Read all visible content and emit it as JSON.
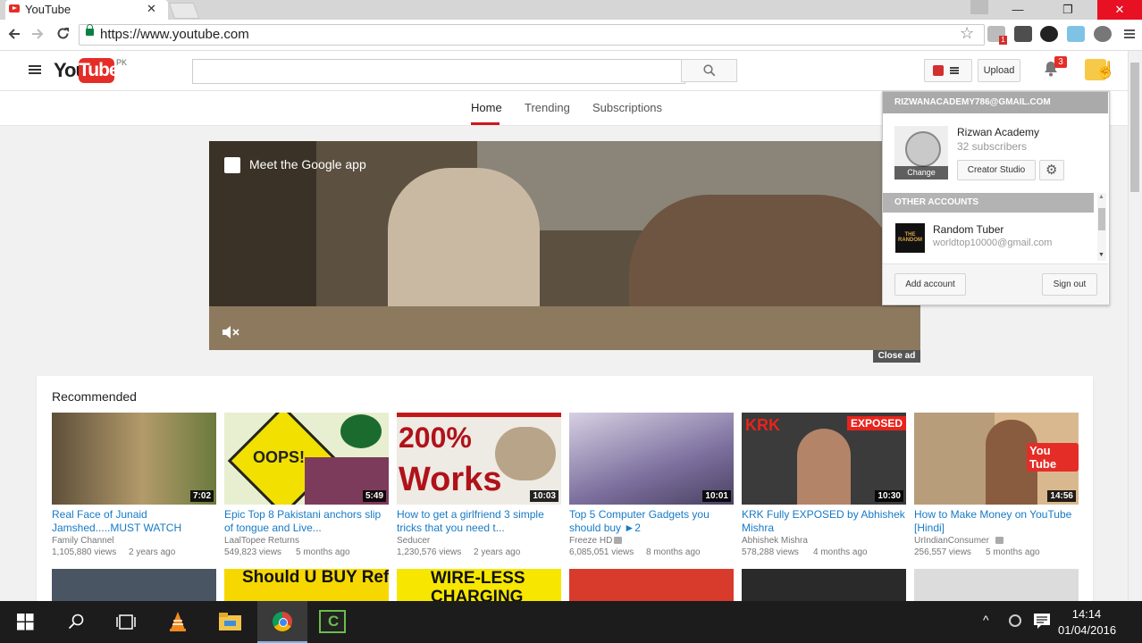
{
  "browser": {
    "tab_title": "YouTube",
    "tab_close": "✕",
    "url": "https://www.youtube.com",
    "window_controls": [
      "—",
      "❐",
      "✕"
    ],
    "ext_badge": "1"
  },
  "header": {
    "logo_you": "You",
    "logo_tube": "Tube",
    "logo_region": "PK",
    "search_placeholder": "",
    "upload_label": "Upload",
    "notification_count": "3"
  },
  "guide_tabs": [
    {
      "label": "Home",
      "active": true
    },
    {
      "label": "Trending",
      "active": false
    },
    {
      "label": "Subscriptions",
      "active": false
    }
  ],
  "ad": {
    "text": "Meet the Google app",
    "close_label": "Close ad"
  },
  "account_menu": {
    "email": "RIZWANACADEMY786@GMAIL.COM",
    "channel_name": "Rizwan Academy",
    "subscribers": "32 subscribers",
    "avatar_caption": "Change",
    "creator_studio_label": "Creator Studio",
    "other_accounts_label": "OTHER ACCOUNTS",
    "other_account_name": "Random Tuber",
    "other_account_email": "worldtop10000@gmail.com",
    "other_account_avatar_text": "THE RANDOM",
    "add_account_label": "Add account",
    "sign_out_label": "Sign out"
  },
  "recommended": {
    "title": "Recommended",
    "videos": [
      {
        "title": "Real Face of Junaid Jamshed.....MUST WATCH",
        "channel": "Family Channel",
        "views": "1,105,880 views",
        "age": "2 years ago",
        "duration": "7:02",
        "color": "#7a6a4e"
      },
      {
        "title": "Epic Top 8 Pakistani anchors slip of tongue and Live...",
        "channel": "LaalTopee Returns",
        "views": "549,823 views",
        "age": "5 months ago",
        "duration": "5:49",
        "color": "#c9d94a"
      },
      {
        "title": "How to get a girlfriend 3 simple tricks that you need t...",
        "channel": "Seducer",
        "views": "1,230,576 views",
        "age": "2 years ago",
        "duration": "10:03",
        "color": "#e8e4de"
      },
      {
        "title": "Top 5 Computer Gadgets you should buy ►2",
        "channel": "Freeze HD",
        "views": "6,085,051 views",
        "age": "8 months ago",
        "duration": "10:01",
        "color": "#a9a3c4"
      },
      {
        "title": "KRK Fully EXPOSED by Abhishek Mishra",
        "channel": "Abhishek Mishra",
        "views": "578,288 views",
        "age": "4 months ago",
        "duration": "10:30",
        "color": "#3b3b3b"
      },
      {
        "title": "How to Make Money on YouTube [Hindi]",
        "channel": "UrIndianConsumer",
        "views": "256,557 views",
        "age": "5 months ago",
        "duration": "14:56",
        "color": "#d9b890"
      }
    ],
    "thumb_200": "200%",
    "thumb_works": "Works",
    "thumb_oops": "OOPS!",
    "thumb_krk": "KRK",
    "thumb_exposed": "EXPOSED",
    "thumb_yt": "You Tube",
    "row2": [
      {
        "color": "#4a5563",
        "text": ""
      },
      {
        "color": "#f6d800",
        "text": "Should U BUY Refurbished"
      },
      {
        "color": "#f6e600",
        "text": "WIRE-LESS CHARGING"
      },
      {
        "color": "#d83a2c",
        "text": ""
      },
      {
        "color": "#2a2a2a",
        "text": ""
      },
      {
        "color": "#dcdcdc",
        "text": ""
      }
    ]
  },
  "taskbar": {
    "time": "14:14",
    "date": "01/04/2016"
  },
  "colors": {
    "brand": "#e52d27",
    "link": "#167ac6",
    "tab_underline": "#cc181e"
  }
}
